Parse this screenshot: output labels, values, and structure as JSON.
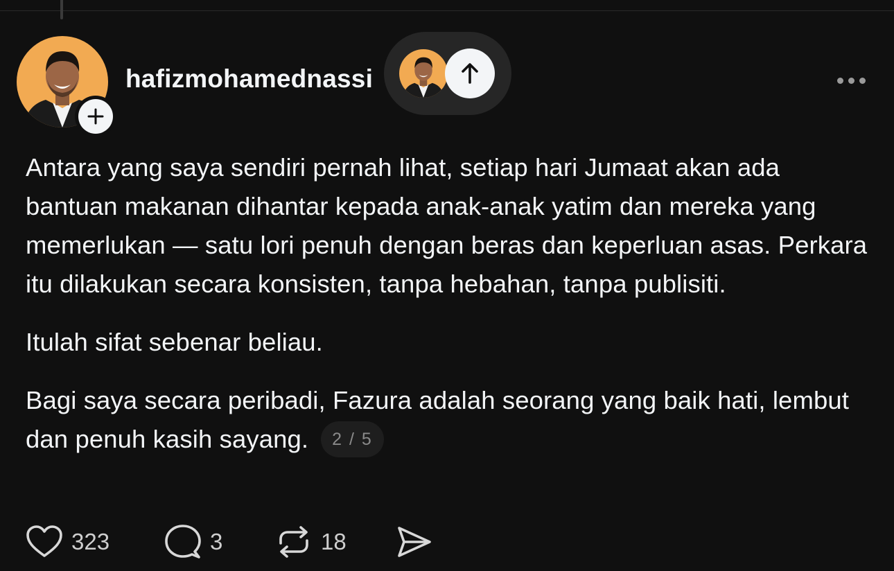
{
  "post": {
    "username": "hafizmohamednassi",
    "avatar_icon": "profile-photo",
    "follow_icon": "plus-icon",
    "scroll_icon": "arrow-up-icon",
    "more_icon": "ellipsis-icon",
    "paragraphs": [
      "Antara yang saya sendiri pernah lihat, setiap hari Jumaat akan ada bantuan makanan dihantar kepada anak-anak yatim dan mereka yang memerlukan — satu lori penuh dengan beras dan keperluan asas. Perkara itu dilakukan secara konsisten, tanpa hebahan, tanpa publisiti.",
      "Itulah sifat sebenar beliau.",
      "Bagi saya secara peribadi, Fazura adalah seorang yang baik hati, lembut dan penuh kasih sayang."
    ],
    "page_indicator": "2 / 5"
  },
  "actions": {
    "likes": "323",
    "replies": "3",
    "reposts": "18"
  },
  "colors": {
    "background": "#101010",
    "text": "#f3f5f7",
    "avatar_bg": "#f2aa52",
    "pill_bg": "#262626"
  }
}
